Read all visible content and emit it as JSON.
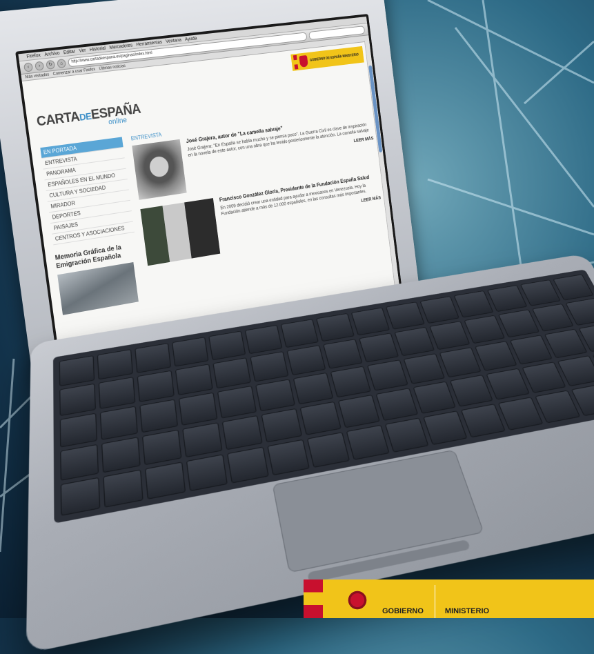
{
  "browser": {
    "menu": [
      "Firefox",
      "Archivo",
      "Editar",
      "Ver",
      "Historial",
      "Marcadores",
      "Herramientas",
      "Ventana",
      "Ayuda"
    ],
    "url": "http://www.cartadeespana.es/paginas/index.html",
    "search_placeholder": "",
    "bookmarks": [
      "Más visitados",
      "Comenzar a usar Firefox",
      "Últimas noticias"
    ]
  },
  "site": {
    "logo_main": "CARTA",
    "logo_mid": "DE",
    "logo_end": "ESPAÑA",
    "logo_sub": "online",
    "gov_banner": "GOBIERNO DE ESPAÑA  MINISTERIO"
  },
  "sidebar": {
    "items": [
      {
        "label": "EN PORTADA",
        "active": true
      },
      {
        "label": "ENTREVISTA"
      },
      {
        "label": "PANORAMA"
      },
      {
        "label": "ESPAÑOLES EN EL MUNDO"
      },
      {
        "label": "CULTURA Y SOCIEDAD"
      },
      {
        "label": "MIRADOR"
      },
      {
        "label": "DEPORTES"
      },
      {
        "label": "PAISAJES"
      },
      {
        "label": "CENTROS Y ASOCIACIONES"
      }
    ],
    "memoria": "Memoria Gráfica de la Emigración Española"
  },
  "main": {
    "section_label": "ENTREVISTA",
    "articles": [
      {
        "title": "José Grajera, autor de \"La camelia salvaje\"",
        "text": "José Grajera: \"En España se habla mucho y se piensa poco\". La Guerra Civil es clave de inspiración en la novela de este autor, con una obra que ha tenido posteriormente la atención. La camelia salvaje",
        "more": "LEER MÁS"
      },
      {
        "title": "Francisco González Gloria, Presidente de la Fundación España Salud",
        "text": "En 2009 decidió crear una entidad para ayudar a mexicanos en Venezuela. Hoy la Fundación atiende a más de 12.000 españoles, en las consultas más importantes.",
        "more": "LEER MÁS"
      }
    ]
  },
  "footer": {
    "gobierno": "GOBIERNO",
    "ministerio": "MINISTERIO"
  }
}
